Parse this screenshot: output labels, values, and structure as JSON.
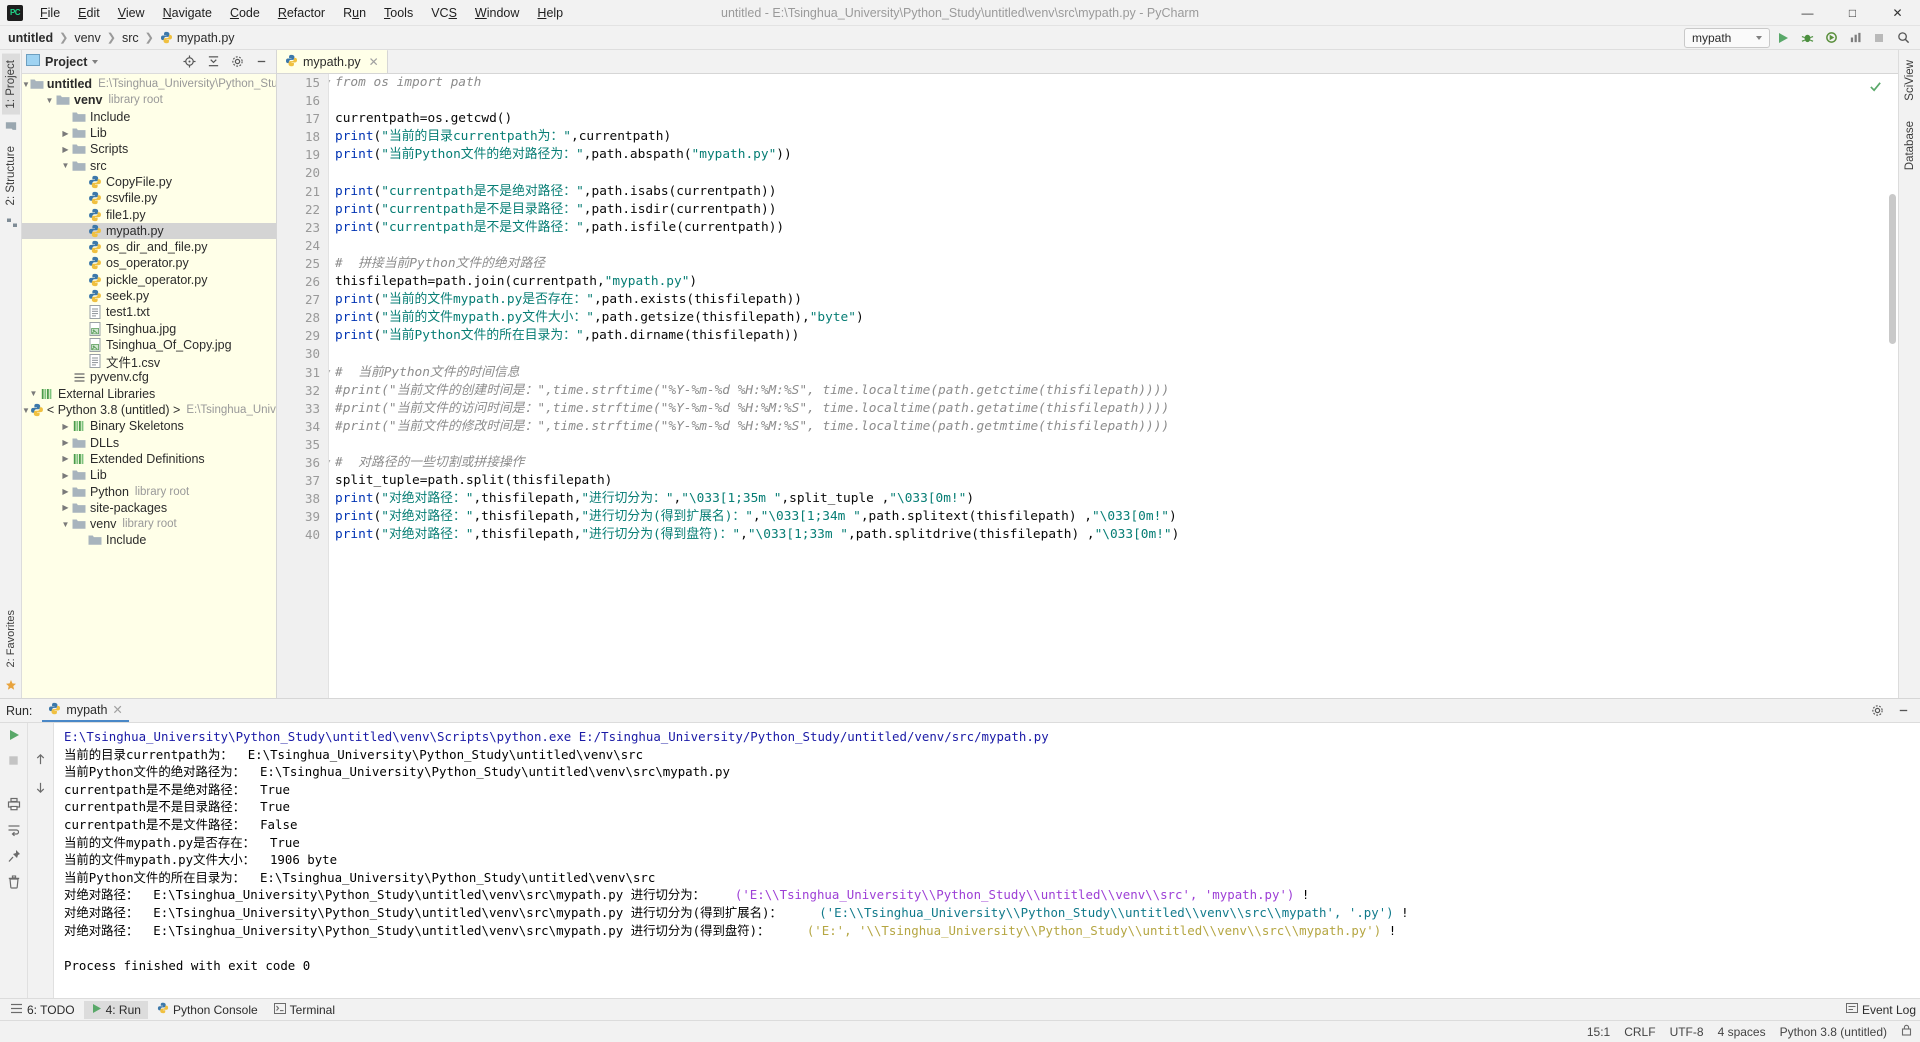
{
  "window": {
    "title": "untitled - E:\\Tsinghua_University\\Python_Study\\untitled\\venv\\src\\mypath.py - PyCharm",
    "minimize": "–",
    "maximize": "☐",
    "close": "✕"
  },
  "menu": [
    "File",
    "Edit",
    "View",
    "Navigate",
    "Code",
    "Refactor",
    "Run",
    "Tools",
    "VCS",
    "Window",
    "Help"
  ],
  "breadcrumb": {
    "items": [
      "untitled",
      "venv",
      "src",
      "mypath.py"
    ],
    "separator": "›"
  },
  "toolbar": {
    "run_config": "mypath",
    "chevron": "▾"
  },
  "left_rail": {
    "project": "1: Project",
    "structure": "2: Structure"
  },
  "right_rail": {
    "sciview": "SciView",
    "database": "Database"
  },
  "project": {
    "title": "Project",
    "chevron": "▾",
    "tree": [
      {
        "depth": 0,
        "arrow": "down",
        "icon": "folder",
        "label": "untitled",
        "bold": true,
        "muted": "E:\\Tsinghua_University\\Python_Study\\u",
        "selected": false
      },
      {
        "depth": 1,
        "arrow": "down",
        "icon": "folder",
        "label": "venv",
        "bold": true,
        "muted": "library root",
        "selected": false
      },
      {
        "depth": 2,
        "arrow": "none",
        "icon": "folder",
        "label": "Include",
        "bold": false,
        "muted": "",
        "selected": false
      },
      {
        "depth": 2,
        "arrow": "right",
        "icon": "folder",
        "label": "Lib",
        "bold": false,
        "muted": "",
        "selected": false
      },
      {
        "depth": 2,
        "arrow": "right",
        "icon": "folder",
        "label": "Scripts",
        "bold": false,
        "muted": "",
        "selected": false
      },
      {
        "depth": 2,
        "arrow": "down",
        "icon": "folder",
        "label": "src",
        "bold": false,
        "muted": "",
        "selected": false
      },
      {
        "depth": 3,
        "arrow": "none",
        "icon": "py",
        "label": "CopyFile.py",
        "bold": false,
        "muted": "",
        "selected": false
      },
      {
        "depth": 3,
        "arrow": "none",
        "icon": "py",
        "label": "csvfile.py",
        "bold": false,
        "muted": "",
        "selected": false
      },
      {
        "depth": 3,
        "arrow": "none",
        "icon": "py",
        "label": "file1.py",
        "bold": false,
        "muted": "",
        "selected": false
      },
      {
        "depth": 3,
        "arrow": "none",
        "icon": "py",
        "label": "mypath.py",
        "bold": false,
        "muted": "",
        "selected": true
      },
      {
        "depth": 3,
        "arrow": "none",
        "icon": "py",
        "label": "os_dir_and_file.py",
        "bold": false,
        "muted": "",
        "selected": false
      },
      {
        "depth": 3,
        "arrow": "none",
        "icon": "py",
        "label": "os_operator.py",
        "bold": false,
        "muted": "",
        "selected": false
      },
      {
        "depth": 3,
        "arrow": "none",
        "icon": "py",
        "label": "pickle_operator.py",
        "bold": false,
        "muted": "",
        "selected": false
      },
      {
        "depth": 3,
        "arrow": "none",
        "icon": "py",
        "label": "seek.py",
        "bold": false,
        "muted": "",
        "selected": false
      },
      {
        "depth": 3,
        "arrow": "none",
        "icon": "txt",
        "label": "test1.txt",
        "bold": false,
        "muted": "",
        "selected": false
      },
      {
        "depth": 3,
        "arrow": "none",
        "icon": "img",
        "label": "Tsinghua.jpg",
        "bold": false,
        "muted": "",
        "selected": false
      },
      {
        "depth": 3,
        "arrow": "none",
        "icon": "img",
        "label": "Tsinghua_Of_Copy.jpg",
        "bold": false,
        "muted": "",
        "selected": false
      },
      {
        "depth": 3,
        "arrow": "none",
        "icon": "txt",
        "label": "文件1.csv",
        "bold": false,
        "muted": "",
        "selected": false
      },
      {
        "depth": 2,
        "arrow": "none",
        "icon": "cfg",
        "label": "pyvenv.cfg",
        "bold": false,
        "muted": "",
        "selected": false
      },
      {
        "depth": 0,
        "arrow": "down",
        "icon": "lib",
        "label": "External Libraries",
        "bold": false,
        "muted": "",
        "selected": false
      },
      {
        "depth": 1,
        "arrow": "down",
        "icon": "python",
        "label": "< Python 3.8 (untitled) >",
        "bold": false,
        "muted": "E:\\Tsinghua_Univers",
        "selected": false
      },
      {
        "depth": 2,
        "arrow": "right",
        "icon": "lib",
        "label": "Binary Skeletons",
        "bold": false,
        "muted": "",
        "selected": false
      },
      {
        "depth": 2,
        "arrow": "right",
        "icon": "folder",
        "label": "DLLs",
        "bold": false,
        "muted": "",
        "selected": false
      },
      {
        "depth": 2,
        "arrow": "right",
        "icon": "lib",
        "label": "Extended Definitions",
        "bold": false,
        "muted": "",
        "selected": false
      },
      {
        "depth": 2,
        "arrow": "right",
        "icon": "folder",
        "label": "Lib",
        "bold": false,
        "muted": "",
        "selected": false
      },
      {
        "depth": 2,
        "arrow": "right",
        "icon": "folder",
        "label": "Python",
        "bold": false,
        "muted": "library root",
        "selected": false
      },
      {
        "depth": 2,
        "arrow": "right",
        "icon": "folder",
        "label": "site-packages",
        "bold": false,
        "muted": "",
        "selected": false
      },
      {
        "depth": 2,
        "arrow": "down",
        "icon": "folder",
        "label": "venv",
        "bold": false,
        "muted": "library root",
        "selected": false
      },
      {
        "depth": 3,
        "arrow": "none",
        "icon": "folder",
        "label": "Include",
        "bold": false,
        "muted": "",
        "selected": false
      }
    ]
  },
  "editor": {
    "tab": {
      "label": "mypath.py",
      "close": "✕"
    },
    "first_line_number": 15,
    "lines": [
      {
        "n": 15,
        "tokens": [
          {
            "t": "cmt",
            "v": "from os import path"
          }
        ],
        "fold": true
      },
      {
        "n": 16,
        "tokens": []
      },
      {
        "n": 17,
        "tokens": [
          {
            "t": "plain",
            "v": "currentpath=os.getcwd()"
          }
        ]
      },
      {
        "n": 18,
        "tokens": [
          {
            "t": "kw",
            "v": "print"
          },
          {
            "t": "plain",
            "v": "("
          },
          {
            "t": "str",
            "v": "\"当前的目录currentpath为：\""
          },
          {
            "t": "plain",
            "v": ",currentpath)"
          }
        ]
      },
      {
        "n": 19,
        "tokens": [
          {
            "t": "kw",
            "v": "print"
          },
          {
            "t": "plain",
            "v": "("
          },
          {
            "t": "str",
            "v": "\"当前Python文件的绝对路径为：\""
          },
          {
            "t": "plain",
            "v": ",path.abspath("
          },
          {
            "t": "str",
            "v": "\"mypath.py\""
          },
          {
            "t": "plain",
            "v": "))"
          }
        ]
      },
      {
        "n": 20,
        "tokens": []
      },
      {
        "n": 21,
        "tokens": [
          {
            "t": "kw",
            "v": "print"
          },
          {
            "t": "plain",
            "v": "("
          },
          {
            "t": "str",
            "v": "\"currentpath是不是绝对路径：\""
          },
          {
            "t": "plain",
            "v": ",path.isabs(currentpath))"
          }
        ]
      },
      {
        "n": 22,
        "tokens": [
          {
            "t": "kw",
            "v": "print"
          },
          {
            "t": "plain",
            "v": "("
          },
          {
            "t": "str",
            "v": "\"currentpath是不是目录路径：\""
          },
          {
            "t": "plain",
            "v": ",path.isdir(currentpath))"
          }
        ]
      },
      {
        "n": 23,
        "tokens": [
          {
            "t": "kw",
            "v": "print"
          },
          {
            "t": "plain",
            "v": "("
          },
          {
            "t": "str",
            "v": "\"currentpath是不是文件路径：\""
          },
          {
            "t": "plain",
            "v": ",path.isfile(currentpath))"
          }
        ]
      },
      {
        "n": 24,
        "tokens": []
      },
      {
        "n": 25,
        "tokens": [
          {
            "t": "cmt",
            "v": "#  拼接当前Python文件的绝对路径"
          }
        ]
      },
      {
        "n": 26,
        "tokens": [
          {
            "t": "plain",
            "v": "thisfilepath=path.join(currentpath,"
          },
          {
            "t": "str",
            "v": "\"mypath.py\""
          },
          {
            "t": "plain",
            "v": ")"
          }
        ]
      },
      {
        "n": 27,
        "tokens": [
          {
            "t": "kw",
            "v": "print"
          },
          {
            "t": "plain",
            "v": "("
          },
          {
            "t": "str",
            "v": "\"当前的文件mypath.py是否存在：\""
          },
          {
            "t": "plain",
            "v": ",path.exists(thisfilepath))"
          }
        ]
      },
      {
        "n": 28,
        "tokens": [
          {
            "t": "kw",
            "v": "print"
          },
          {
            "t": "plain",
            "v": "("
          },
          {
            "t": "str",
            "v": "\"当前的文件mypath.py文件大小：\""
          },
          {
            "t": "plain",
            "v": ",path.getsize(thisfilepath),"
          },
          {
            "t": "str",
            "v": "\"byte\""
          },
          {
            "t": "plain",
            "v": ")"
          }
        ]
      },
      {
        "n": 29,
        "tokens": [
          {
            "t": "kw",
            "v": "print"
          },
          {
            "t": "plain",
            "v": "("
          },
          {
            "t": "str",
            "v": "\"当前Python文件的所在目录为：\""
          },
          {
            "t": "plain",
            "v": ",path.dirname(thisfilepath))"
          }
        ]
      },
      {
        "n": 30,
        "tokens": []
      },
      {
        "n": 31,
        "tokens": [
          {
            "t": "cmt",
            "v": "#  当前Python文件的时间信息"
          }
        ],
        "fold": true
      },
      {
        "n": 32,
        "tokens": [
          {
            "t": "cmt",
            "v": "#print(\"当前文件的创建时间是：\",time.strftime(\"%Y-%m-%d %H:%M:%S\", time.localtime(path.getctime(thisfilepath))))"
          }
        ]
      },
      {
        "n": 33,
        "tokens": [
          {
            "t": "cmt",
            "v": "#print(\"当前文件的访问时间是：\",time.strftime(\"%Y-%m-%d %H:%M:%S\", time.localtime(path.getatime(thisfilepath))))"
          }
        ]
      },
      {
        "n": 34,
        "tokens": [
          {
            "t": "cmt",
            "v": "#print(\"当前文件的修改时间是：\",time.strftime(\"%Y-%m-%d %H:%M:%S\", time.localtime(path.getmtime(thisfilepath))))"
          }
        ]
      },
      {
        "n": 35,
        "tokens": []
      },
      {
        "n": 36,
        "tokens": [
          {
            "t": "cmt",
            "v": "#  对路径的一些切割或拼接操作"
          }
        ],
        "fold": true
      },
      {
        "n": 37,
        "tokens": [
          {
            "t": "plain",
            "v": "split_tuple=path.split(thisfilepath)"
          }
        ]
      },
      {
        "n": 38,
        "tokens": [
          {
            "t": "kw",
            "v": "print"
          },
          {
            "t": "plain",
            "v": "("
          },
          {
            "t": "str",
            "v": "\"对绝对路径：\""
          },
          {
            "t": "plain",
            "v": ",thisfilepath,"
          },
          {
            "t": "str",
            "v": "\"进行切分为：\""
          },
          {
            "t": "plain",
            "v": ","
          },
          {
            "t": "str",
            "v": "\"\\033[1;35m \""
          },
          {
            "t": "plain",
            "v": ",split_tuple ,"
          },
          {
            "t": "str",
            "v": "\"\\033[0m!\""
          },
          {
            "t": "plain",
            "v": ")"
          }
        ]
      },
      {
        "n": 39,
        "tokens": [
          {
            "t": "kw",
            "v": "print"
          },
          {
            "t": "plain",
            "v": "("
          },
          {
            "t": "str",
            "v": "\"对绝对路径：\""
          },
          {
            "t": "plain",
            "v": ",thisfilepath,"
          },
          {
            "t": "str",
            "v": "\"进行切分为(得到扩展名)：\""
          },
          {
            "t": "plain",
            "v": ","
          },
          {
            "t": "str",
            "v": "\"\\033[1;34m \""
          },
          {
            "t": "plain",
            "v": ",path.splitext(thisfilepath) ,"
          },
          {
            "t": "str",
            "v": "\"\\033[0m!\""
          },
          {
            "t": "plain",
            "v": ")"
          }
        ]
      },
      {
        "n": 40,
        "tokens": [
          {
            "t": "kw",
            "v": "print"
          },
          {
            "t": "plain",
            "v": "("
          },
          {
            "t": "str",
            "v": "\"对绝对路径：\""
          },
          {
            "t": "plain",
            "v": ",thisfilepath,"
          },
          {
            "t": "str",
            "v": "\"进行切分为(得到盘符)：\""
          },
          {
            "t": "plain",
            "v": ","
          },
          {
            "t": "str",
            "v": "\"\\033[1;33m \""
          },
          {
            "t": "plain",
            "v": ",path.splitdrive(thisfilepath) ,"
          },
          {
            "t": "str",
            "v": "\"\\033[0m!\""
          },
          {
            "t": "plain",
            "v": ")"
          }
        ]
      }
    ]
  },
  "run": {
    "label": "Run:",
    "tab": "mypath",
    "tab_close": "✕",
    "console": [
      {
        "segments": [
          {
            "c": "blue",
            "v": "E:\\Tsinghua_University\\Python_Study\\untitled\\venv\\Scripts\\python.exe E:/Tsinghua_University/Python_Study/untitled/venv/src/mypath.py"
          }
        ]
      },
      {
        "segments": [
          {
            "c": "black",
            "v": "当前的目录currentpath为：  E:\\Tsinghua_University\\Python_Study\\untitled\\venv\\src"
          }
        ]
      },
      {
        "segments": [
          {
            "c": "black",
            "v": "当前Python文件的绝对路径为：  E:\\Tsinghua_University\\Python_Study\\untitled\\venv\\src\\mypath.py"
          }
        ]
      },
      {
        "segments": [
          {
            "c": "black",
            "v": "currentpath是不是绝对路径：  True"
          }
        ]
      },
      {
        "segments": [
          {
            "c": "black",
            "v": "currentpath是不是目录路径：  True"
          }
        ]
      },
      {
        "segments": [
          {
            "c": "black",
            "v": "currentpath是不是文件路径：  False"
          }
        ]
      },
      {
        "segments": [
          {
            "c": "black",
            "v": "当前的文件mypath.py是否存在：  True"
          }
        ]
      },
      {
        "segments": [
          {
            "c": "black",
            "v": "当前的文件mypath.py文件大小：  1906 byte"
          }
        ]
      },
      {
        "segments": [
          {
            "c": "black",
            "v": "当前Python文件的所在目录为：  E:\\Tsinghua_University\\Python_Study\\untitled\\venv\\src"
          }
        ]
      },
      {
        "segments": [
          {
            "c": "black",
            "v": "对绝对路径：  E:\\Tsinghua_University\\Python_Study\\untitled\\venv\\src\\mypath.py 进行切分为：   "
          },
          {
            "c": "purple",
            "v": " ('E:\\\\Tsinghua_University\\\\Python_Study\\\\untitled\\\\venv\\\\src', 'mypath.py') "
          },
          {
            "c": "black",
            "v": "!"
          }
        ]
      },
      {
        "segments": [
          {
            "c": "black",
            "v": "对绝对路径：  E:\\Tsinghua_University\\Python_Study\\untitled\\venv\\src\\mypath.py 进行切分为(得到扩展名)：    "
          },
          {
            "c": "teal",
            "v": " ('E:\\\\Tsinghua_University\\\\Python_Study\\\\untitled\\\\venv\\\\src\\\\mypath', '.py') "
          },
          {
            "c": "black",
            "v": "!"
          }
        ]
      },
      {
        "segments": [
          {
            "c": "black",
            "v": "对绝对路径：  E:\\Tsinghua_University\\Python_Study\\untitled\\venv\\src\\mypath.py 进行切分为(得到盘符)：    "
          },
          {
            "c": "yellow",
            "v": " ('E:', '\\\\Tsinghua_University\\\\Python_Study\\\\untitled\\\\venv\\\\src\\\\mypath.py') "
          },
          {
            "c": "black",
            "v": "!"
          }
        ]
      },
      {
        "segments": []
      },
      {
        "segments": [
          {
            "c": "black",
            "v": "Process finished with exit code 0"
          }
        ]
      }
    ]
  },
  "bottombar": {
    "items": [
      {
        "label": "6: TODO",
        "icon": "list-icon",
        "active": false
      },
      {
        "label": "4: Run",
        "icon": "run-icon",
        "active": true
      },
      {
        "label": "Python Console",
        "icon": "python-icon",
        "active": false
      },
      {
        "label": "Terminal",
        "icon": "terminal-icon",
        "active": false
      }
    ],
    "event_log": "Event Log"
  },
  "statusbar": {
    "caret": "15:1",
    "line_sep": "CRLF",
    "encoding": "UTF-8",
    "indent": "4 spaces",
    "interpreter": "Python 3.8 (untitled)",
    "lock": "🔒"
  },
  "colors": {
    "keyword": "#0033b3",
    "string": "#067d74",
    "comment": "#8c8c8c",
    "tree_bg": "#ffffe8",
    "selection": "#d4d4d4",
    "console_blue": "#1a1aa6",
    "console_purple": "#9d3fd6",
    "console_teal": "#117a8b",
    "console_yellow": "#b5a642"
  }
}
